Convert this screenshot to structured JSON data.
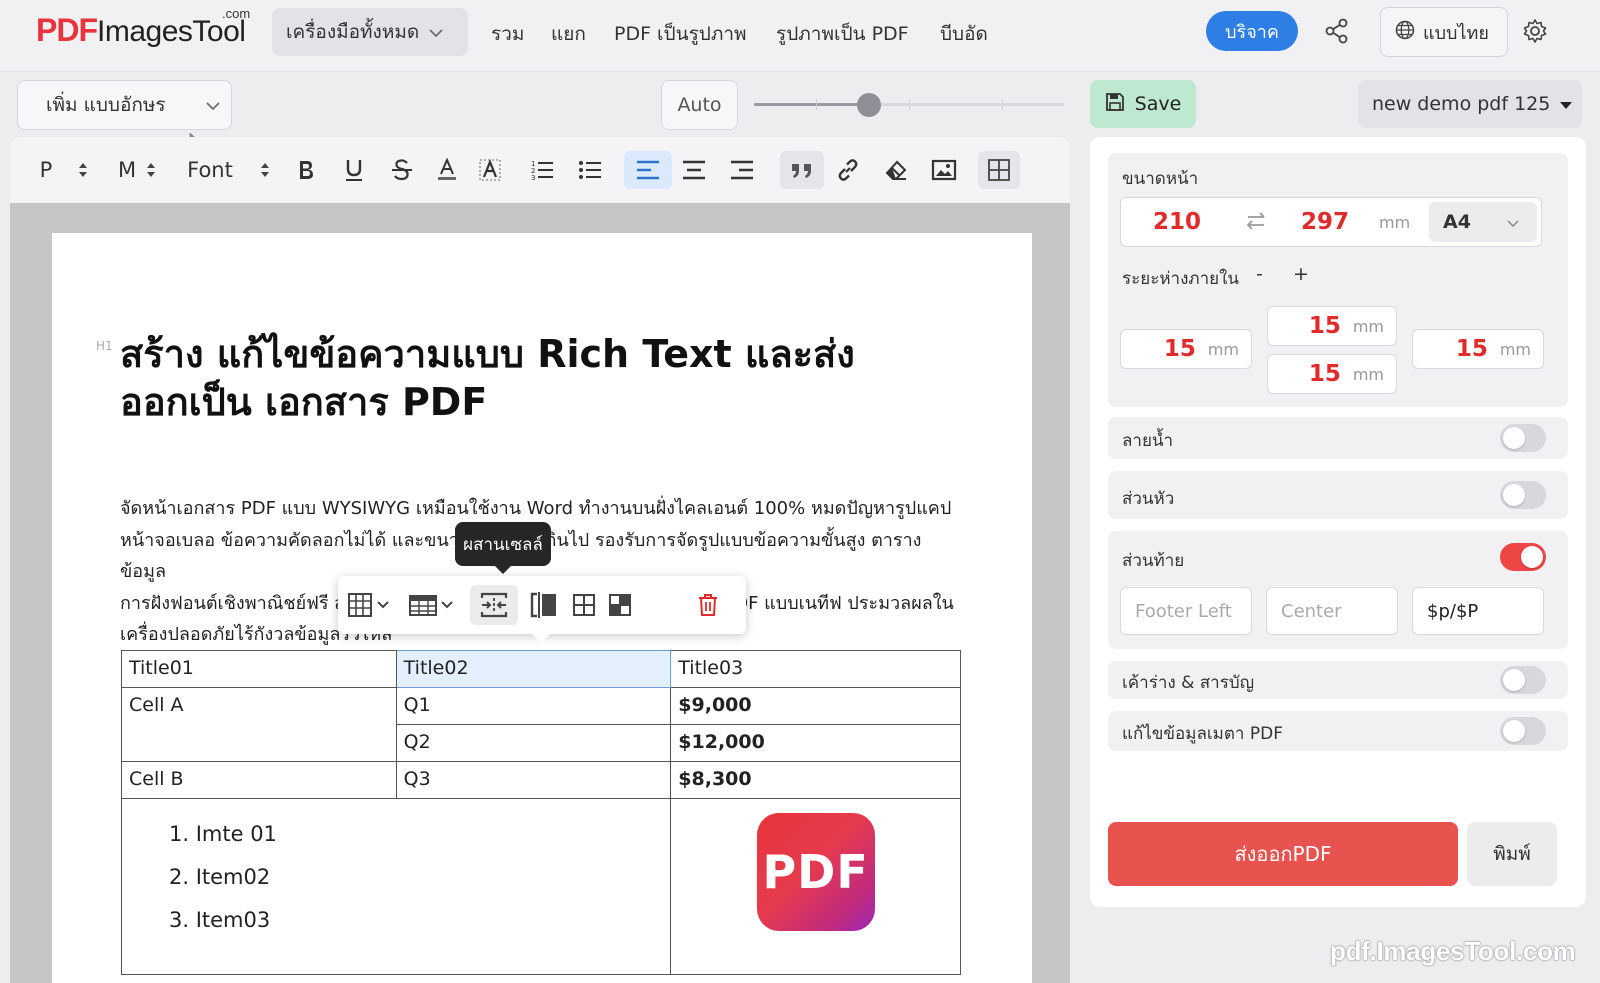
{
  "nav": {
    "logo_pdf": "PDF",
    "logo_rest": "ImagesTool",
    "logo_com": ".com",
    "all_tools": "เครื่องมือทั้งหมด",
    "links": [
      "รวม",
      "แยก",
      "PDF เป็นรูปภาพ",
      "รูปภาพเป็น PDF",
      "บีบอัด"
    ],
    "donate": "บริจาค",
    "language": "แบบไทย",
    "share_icon": "share-icon",
    "gear_icon": "gear-icon",
    "accent_color": "#2e7ee6"
  },
  "editor": {
    "font_add_select": "เพิ่ม แบบอักษร",
    "zoom_button": "Auto",
    "zoom_level": 0.37,
    "toolbar": {
      "paragraph": "P",
      "size": "M",
      "font": "Font"
    }
  },
  "document": {
    "heading_tag": "H1",
    "title": "สร้าง แก้ไขข้อความแบบ Rich Text และส่งออกเป็น เอกสาร PDF",
    "paragraph": "จัดหน้าเอกสาร PDF แบบ WYSIWYG เหมือนใช้งาน Word ทำงานบนฝั่งไคลเอนต์ 100% หมดปัญหารูปแคป\nหน้าจอเบลอ ข้อความคัดลอกไม่ได้ และขนาดไฟล์ใหญ่เกินไป รองรับการจัดรูปแบบข้อความขั้นสูง ตารางข้อมูล\nการฝังฟอนต์เชิงพาณิชย์ฟรี ส่วนหัว/ส่วนท้ายตามต้องการ และสารบัญบุ๊กมาร์ก PDF แบบเนทีฟ ประมวลผลใน\nเครื่องปลอดภัยไร้กังวลข้อมูลรั่วไหล",
    "tooltip": "ผสานเซลล์",
    "table": {
      "headers": [
        "Title01",
        "Title02",
        "Title03"
      ],
      "rows": [
        [
          "Cell A",
          "Q1",
          "$9,000"
        ],
        [
          "",
          "Q2",
          "$12,000"
        ],
        [
          "Cell B",
          "Q3",
          "$8,300"
        ]
      ],
      "list_items": [
        "1. Imte 01",
        "2. Item02",
        "3. Item03"
      ],
      "image_label": "PDF"
    }
  },
  "panel": {
    "save": "Save",
    "doc_name": "new demo pdf 125",
    "page_size_label": "ขนาดหน้า",
    "width": "210",
    "height": "297",
    "unit": "mm",
    "paper": "A4",
    "padding_label": "ระยะห่างภายใน",
    "padding_minus": "-",
    "padding_plus": "+",
    "padding": {
      "top": "15",
      "left": "15",
      "bottom": "15",
      "right": "15"
    },
    "watermark_label": "ลายน้ำ",
    "watermark_on": false,
    "header_label": "ส่วนหัว",
    "header_on": false,
    "footer_label": "ส่วนท้าย",
    "footer_on": true,
    "footer_left_placeholder": "Footer Left",
    "footer_center_placeholder": "Center",
    "footer_right_value": "$p/$P",
    "outline_label": "เค้าร่าง & สารบัญ",
    "outline_on": false,
    "meta_label": "แก้ไขข้อมูลเมตา PDF",
    "meta_on": false,
    "export": "ส่งออกPDF",
    "print": "พิมพ์",
    "export_color": "#e8524f",
    "toggle_on_color": "#ee4545"
  },
  "watermark_text": "pdf.ImagesTool.com"
}
